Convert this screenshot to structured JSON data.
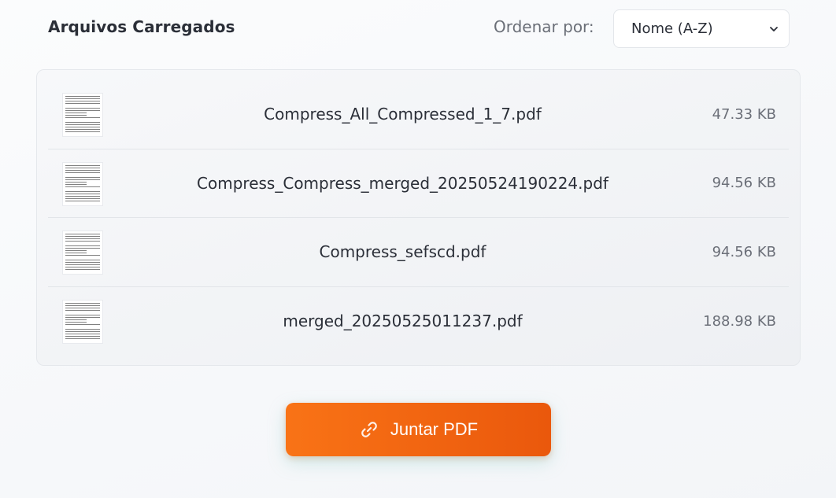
{
  "header": {
    "title": "Arquivos Carregados",
    "sort_label": "Ordenar por:",
    "sort_selected": "Nome (A-Z)"
  },
  "files": [
    {
      "name": "Compress_All_Compressed_1_7.pdf",
      "size": "47.33 KB"
    },
    {
      "name": "Compress_Compress_merged_20250524190224.pdf",
      "size": "94.56 KB"
    },
    {
      "name": "Compress_sefscd.pdf",
      "size": "94.56 KB"
    },
    {
      "name": "merged_20250525011237.pdf",
      "size": "188.98 KB"
    }
  ],
  "action": {
    "merge_label": "Juntar PDF",
    "icon": "link-icon"
  },
  "colors": {
    "accent": "#f97316",
    "accent_dark": "#ea580c"
  }
}
